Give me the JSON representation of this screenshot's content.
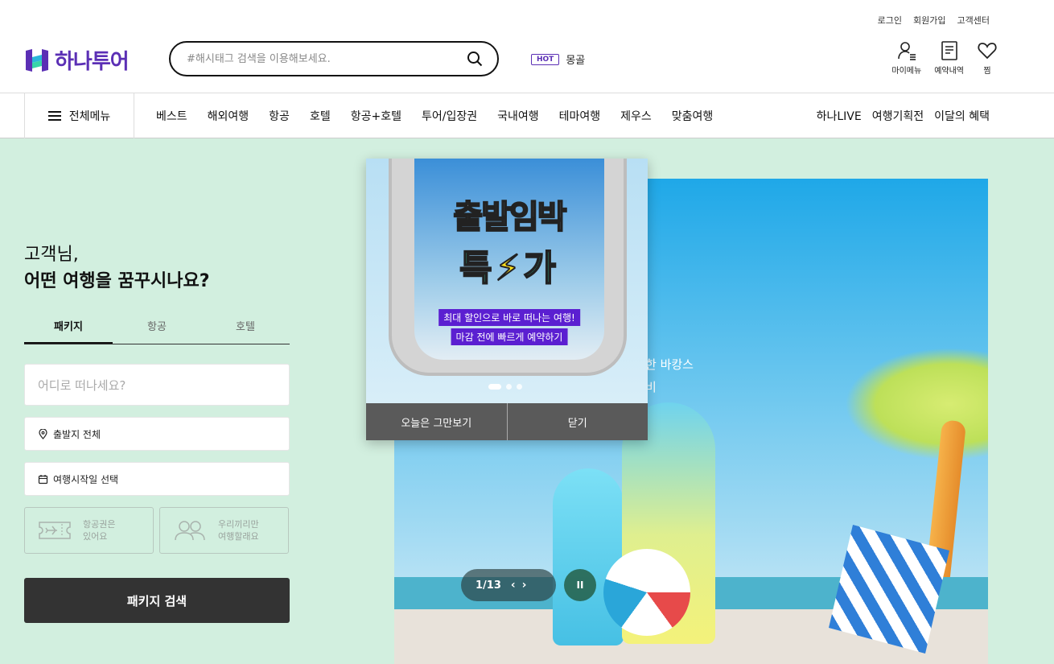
{
  "header": {
    "util_links": [
      "로그인",
      "회원가입",
      "고객센터"
    ],
    "logo_text": "하나투어",
    "search_placeholder": "#해시태그 검색을 이용해보세요.",
    "hot_badge": "HOT",
    "hot_keyword": "몽골",
    "icons": [
      {
        "label": "마이메뉴",
        "icon": "user-menu-icon"
      },
      {
        "label": "예약내역",
        "icon": "document-icon"
      },
      {
        "label": "찜",
        "icon": "heart-icon"
      }
    ]
  },
  "nav": {
    "all_menu": "전체메뉴",
    "items": [
      "베스트",
      "해외여행",
      "항공",
      "호텔",
      "항공+호텔",
      "투어/입장권",
      "국내여행",
      "테마여행",
      "제우스",
      "맞춤여행"
    ],
    "right_items": [
      "하나LIVE",
      "여행기획전",
      "이달의 혜택"
    ]
  },
  "search_panel": {
    "greeting_line1": "고객님,",
    "greeting_line2": "어떤 여행을 꿈꾸시나요?",
    "tabs": [
      "패키지",
      "항공",
      "호텔"
    ],
    "active_tab": "패키지",
    "destination_placeholder": "어디로 떠나세요?",
    "departure": "출발지 전체",
    "start_date": "여행시작일 선택",
    "option1_line1": "항공권은",
    "option1_line2": "있어요",
    "option2_line1": "우리끼리만",
    "option2_line2": "여행할래요",
    "search_button": "패키지 검색"
  },
  "hero": {
    "text_line1": "한 바캉스",
    "text_line2": "비",
    "slide_indicator": "1/13",
    "prev_icon": "‹",
    "next_icon": "›",
    "pause_icon": "II"
  },
  "popup": {
    "title_line1": "출발임박",
    "title_line2_a": "특",
    "title_line2_b": "가",
    "bolt": "⚡",
    "line1": "최대 할인으로 바로 떠나는 여행!",
    "line2": "마감 전에 빠르게 예약하기",
    "btn_hide_today": "오늘은 그만보기",
    "btn_close": "닫기"
  },
  "colors": {
    "brand": "#5b2fb5",
    "main_bg": "#d2efdf",
    "button_dark": "#333333"
  }
}
